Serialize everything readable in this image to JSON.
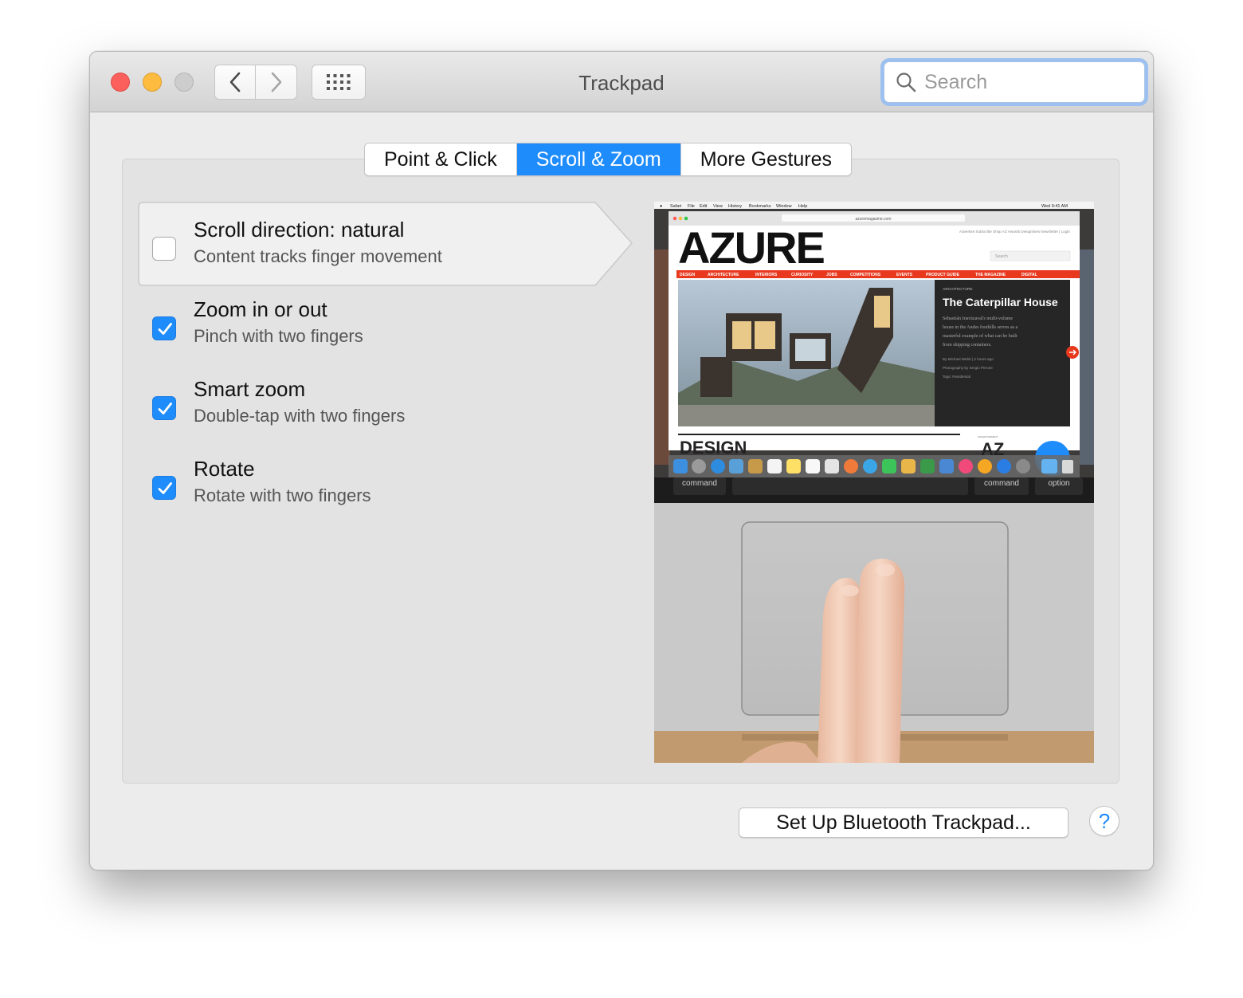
{
  "window": {
    "title": "Trackpad",
    "search_placeholder": "Search"
  },
  "tabs": [
    {
      "label": "Point & Click",
      "active": false
    },
    {
      "label": "Scroll & Zoom",
      "active": true
    },
    {
      "label": "More Gestures",
      "active": false
    }
  ],
  "options": [
    {
      "title": "Scroll direction: natural",
      "subtitle": "Content tracks finger movement",
      "checked": false,
      "selected": true
    },
    {
      "title": "Zoom in or out",
      "subtitle": "Pinch with two fingers",
      "checked": true,
      "selected": false
    },
    {
      "title": "Smart zoom",
      "subtitle": "Double-tap with two fingers",
      "checked": true,
      "selected": false
    },
    {
      "title": "Rotate",
      "subtitle": "Rotate with two fingers",
      "checked": true,
      "selected": false
    }
  ],
  "preview": {
    "menubar": [
      "Safari",
      "File",
      "Edit",
      "View",
      "History",
      "Bookmarks",
      "Window",
      "Help"
    ],
    "clock": "Wed 9:41 AM",
    "url": "azuremagazine.com",
    "site_links": "Advertise  Subscribe  Shop  AZ Awards  Designlines  Newsletter  |  Login",
    "site_search": "Search",
    "logo": "AZURE",
    "nav": [
      "DESIGN",
      "ARCHITECTURE",
      "INTERIORS",
      "CURIOSITY",
      "JOBS",
      "COMPETITIONS",
      "EVENTS",
      "PRODUCT GUIDE",
      "THE MAGAZINE",
      "DIGITAL"
    ],
    "article": {
      "category": "ARCHITECTURE",
      "headline": "The Caterpillar House",
      "body": [
        "Sebastián Irarrázaval's multi-volume",
        "house in the Andes foothills serves as a",
        "masterful example of what can be built",
        "from shipping containers."
      ],
      "byline": "By Michael Webb | 2 hours ago",
      "photo_credit": "Photography by Sergio Pirrone",
      "tags": "Tags: Residential"
    },
    "section_heading": "DESIGN",
    "ad_label": "ADVERTISEMENT",
    "ad_text": "AZ",
    "keys": {
      "left": "command",
      "right": "command",
      "option": "option"
    }
  },
  "footer": {
    "setup_button": "Set Up Bluetooth Trackpad...",
    "help_button": "?"
  },
  "colors": {
    "accent": "#1f8cfb",
    "close": "#fc605c",
    "minimize": "#fdbc40",
    "azure_red": "#e8391f"
  }
}
